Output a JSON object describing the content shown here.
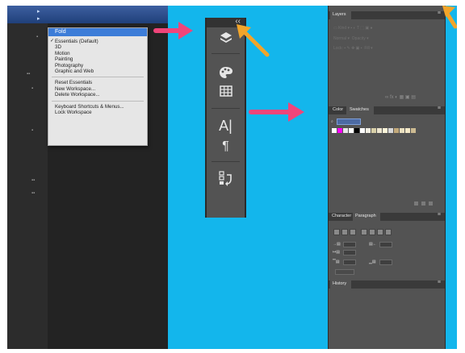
{
  "workspace_menu": {
    "highlighted": "Fold",
    "checked_item": "Essentials (Default)",
    "group1": [
      "3D",
      "Motion",
      "Painting",
      "Photography",
      "Graphic and Web"
    ],
    "group2": [
      "Reset Essentials",
      "New Workspace...",
      "Delete Workspace..."
    ],
    "group3": [
      "Keyboard Shortcuts & Menus...",
      "Lock Workspace"
    ]
  },
  "dock": {
    "collapse_glyph": "‹‹",
    "type_glyph": "A|",
    "para_glyph": "¶"
  },
  "panels": {
    "layers_tab": "Layers",
    "color_tab": "Color",
    "swatches_tab": "Swatches",
    "character_tab": "Character",
    "paragraph_tab": "Paragraph",
    "history_tab": "History",
    "swatch_colors": [
      "#ffffff",
      "#ff00ff",
      "#e8e8e8",
      "#ffffff",
      "#000000",
      "#ffffff",
      "#f2efe3",
      "#d8cfa8",
      "#ede6cf",
      "#fff7d9",
      "#d8d8d8",
      "#c2a97a",
      "#eae0c0",
      "#f5e9c8",
      "#cdbb92"
    ]
  },
  "arrows": {
    "pink_color": "#f0457a",
    "orange_color": "#f2a52a"
  }
}
